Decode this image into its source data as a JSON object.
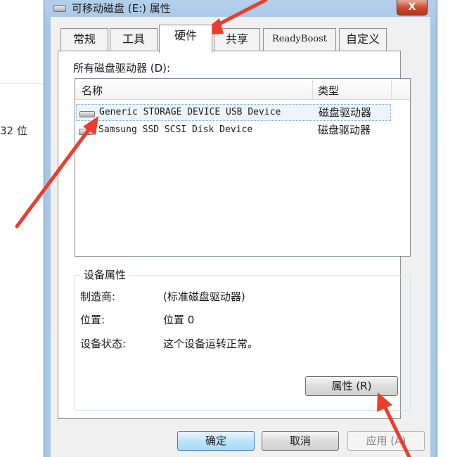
{
  "background": {
    "partial_text": "32 位"
  },
  "window": {
    "title": "可移动磁盘 (E:) 属性",
    "close_symbol": "X"
  },
  "tabs": [
    {
      "label": "常规"
    },
    {
      "label": "工具"
    },
    {
      "label": "硬件",
      "active": true
    },
    {
      "label": "共享"
    },
    {
      "label": "ReadyBoost"
    },
    {
      "label": "自定义"
    }
  ],
  "drives": {
    "label": "所有磁盘驱动器 (D):",
    "columns": {
      "name": "名称",
      "type": "类型"
    },
    "rows": [
      {
        "name": "Generic STORAGE DEVICE USB Device",
        "type": "磁盘驱动器",
        "selected": true
      },
      {
        "name": "Samsung SSD SCSI Disk Device",
        "type": "磁盘驱动器",
        "selected": false
      }
    ]
  },
  "device_properties": {
    "title": "设备属性",
    "manufacturer_label": "制造商:",
    "manufacturer_value": "(标准磁盘驱动器)",
    "location_label": "位置:",
    "location_value": "位置 0",
    "status_label": "设备状态:",
    "status_value": "这个设备运转正常。",
    "properties_button": "属性 (R)"
  },
  "footer": {
    "ok": "确定",
    "cancel": "取消",
    "apply": "应用 (A)"
  },
  "colors": {
    "annotation_arrow": "#ee3b2b",
    "selection": "#eef4fb",
    "frame": "#a9c8e8"
  }
}
